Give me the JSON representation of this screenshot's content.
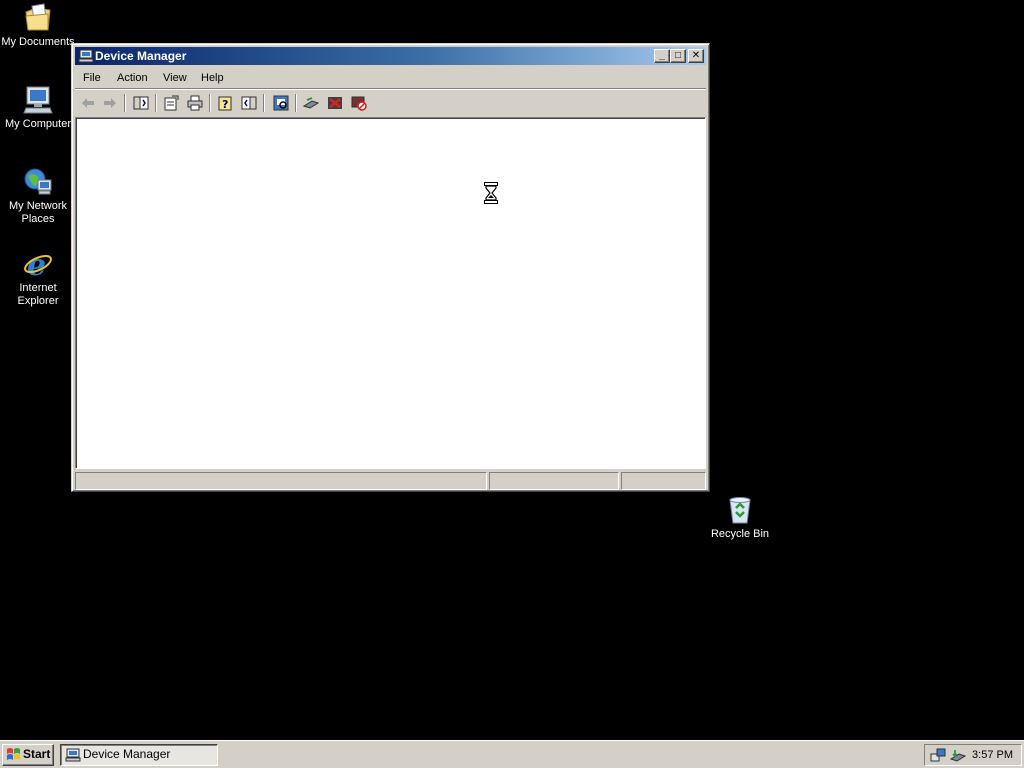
{
  "desktop": {
    "icons": [
      {
        "label": "My Documents",
        "icon": "my-documents-icon"
      },
      {
        "label": "My Computer",
        "icon": "my-computer-icon"
      },
      {
        "label": "My Network Places",
        "icon": "my-network-places-icon"
      },
      {
        "label": "Internet Explorer",
        "icon": "internet-explorer-icon"
      },
      {
        "label": "Recycle Bin",
        "icon": "recycle-bin-icon"
      }
    ]
  },
  "window": {
    "title": "Device Manager",
    "caption_buttons": {
      "minimize": "_",
      "maximize": "□",
      "close": "✕"
    },
    "menu": [
      {
        "label": "File"
      },
      {
        "label": "Action"
      },
      {
        "label": "View"
      },
      {
        "label": "Help"
      }
    ],
    "toolbar": [
      "back-arrow-icon",
      "forward-arrow-icon",
      "show-hide-console-tree-icon",
      "properties-icon",
      "print-icon",
      "help-icon",
      "show-hide-action-pane-icon",
      "scan-hardware-changes-icon",
      "update-driver-icon",
      "uninstall-icon",
      "disable-device-icon"
    ],
    "cursor": "hourglass-icon"
  },
  "taskbar": {
    "start_label": "Start",
    "task_label": "Device Manager",
    "clock": "3:57 PM",
    "tray_icons": [
      "network-connection-icon",
      "safely-remove-hardware-icon"
    ]
  },
  "colors": {
    "desktop_background": "#000000",
    "title_bar_start": "#0a246a",
    "title_bar_end": "#a6caf0",
    "face": "#d4d0c8"
  }
}
